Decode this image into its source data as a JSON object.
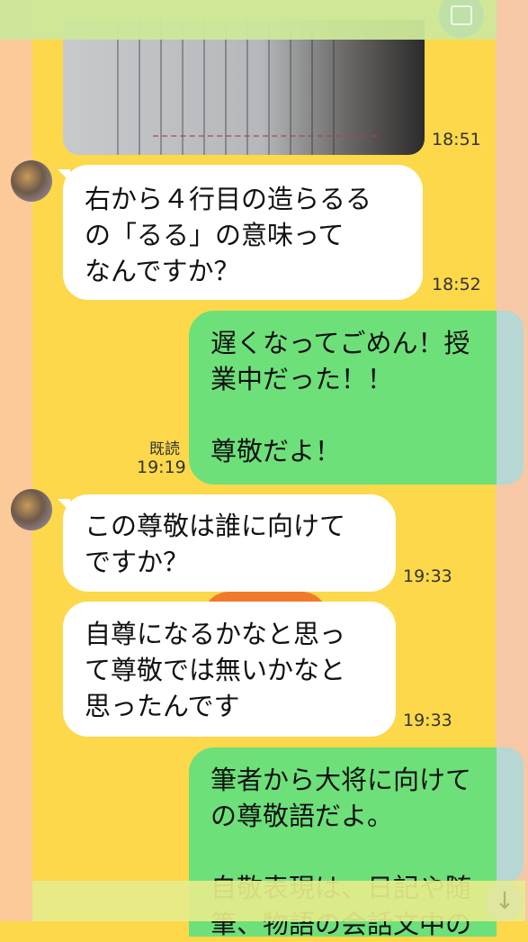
{
  "messages": [
    {
      "type": "image",
      "side": "left",
      "time": "18:51"
    },
    {
      "type": "text",
      "side": "left",
      "text": "右から４行目の造らるる\nの「るる」の意味って\nなんですか？",
      "time": "18:52"
    },
    {
      "type": "text",
      "side": "right",
      "text": "遅くなってごめん！授\n業中だった！！\n\n尊敬だよ！",
      "read": "既読",
      "time": "19:19"
    },
    {
      "type": "text",
      "side": "left",
      "text": "この尊敬は誰に向けて\nですか？",
      "time": "19:33"
    },
    {
      "type": "text",
      "side": "left",
      "text": "自尊になるかなと思っ\nて尊敬では無いかなと\n思ったんです",
      "time": "19:33"
    },
    {
      "type": "text",
      "side": "right",
      "text": "筆者から大将に向けて\nの尊敬語だよ。\n\n自敬表現は、日記や随\n筆、物語の会話文中の",
      "time": ""
    }
  ],
  "icons": {
    "top_right": "keep-icon",
    "scroll_down": "arrow-down-icon"
  }
}
